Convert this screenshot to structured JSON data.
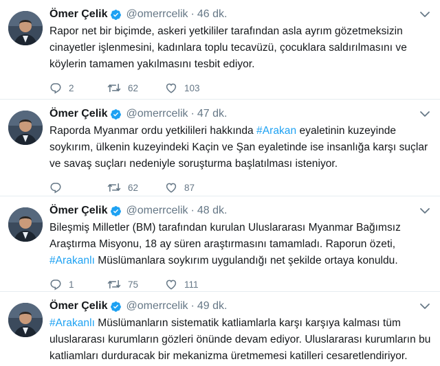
{
  "tweets": [
    {
      "name": "Ömer Çelik",
      "handle": "@omerrcelik",
      "dot": "·",
      "time": "46 dk.",
      "text_parts": [
        {
          "type": "text",
          "value": "Rapor net bir biçimde, askeri yetkililer tarafından asla ayrım gözetmeksizin cinayetler işlenmesini, kadınlara toplu tecavüzü, çocuklara saldırılmasını ve köylerin tamamen yakılmasını tesbit ediyor."
        }
      ],
      "replies": "2",
      "retweets": "62",
      "likes": "103"
    },
    {
      "name": "Ömer Çelik",
      "handle": "@omerrcelik",
      "dot": "·",
      "time": "47 dk.",
      "text_parts": [
        {
          "type": "text",
          "value": "Raporda Myanmar ordu yetkilileri hakkında "
        },
        {
          "type": "tag",
          "value": "#Arakan"
        },
        {
          "type": "text",
          "value": " eyaletinin kuzeyinde soykırım, ülkenin kuzeyindeki Kaçin ve Şan eyaletinde ise insanlığa karşı suçlar ve savaş suçları nedeniyle soruşturma başlatılması isteniyor."
        }
      ],
      "replies": "",
      "retweets": "62",
      "likes": "87"
    },
    {
      "name": "Ömer Çelik",
      "handle": "@omerrcelik",
      "dot": "·",
      "time": "48 dk.",
      "text_parts": [
        {
          "type": "text",
          "value": "Bileşmiş Milletler (BM) tarafından kurulan Uluslararası Myanmar Bağımsız Araştırma Misyonu, 18 ay süren araştırmasını tamamladı. Raporun özeti, "
        },
        {
          "type": "tag",
          "value": "#Arakanlı"
        },
        {
          "type": "text",
          "value": " Müslümanlara soykırım uygulandığı net şekilde ortaya konuldu."
        }
      ],
      "replies": "1",
      "retweets": "75",
      "likes": "111"
    },
    {
      "name": "Ömer Çelik",
      "handle": "@omerrcelik",
      "dot": "·",
      "time": "49 dk.",
      "text_parts": [
        {
          "type": "tag",
          "value": "#Arakanlı"
        },
        {
          "type": "text",
          "value": " Müslümanların sistematik katliamlarla karşı karşıya kalması tüm uluslararası kurumların gözleri önünde devam ediyor. Uluslararası kurumların bu katliamları durduracak bir mekanizma üretmemesi katilleri cesaretlendiriyor."
        }
      ],
      "replies": null,
      "retweets": null,
      "likes": null
    }
  ],
  "colors": {
    "link": "#1da1f2",
    "secondary": "#657786",
    "verified": "#1da1f2",
    "divider": "#e6ecf0"
  },
  "icons": {
    "reply": "reply-icon",
    "retweet": "retweet-icon",
    "like": "like-icon",
    "verified": "verified-badge-icon",
    "menu": "chevron-down-icon"
  }
}
